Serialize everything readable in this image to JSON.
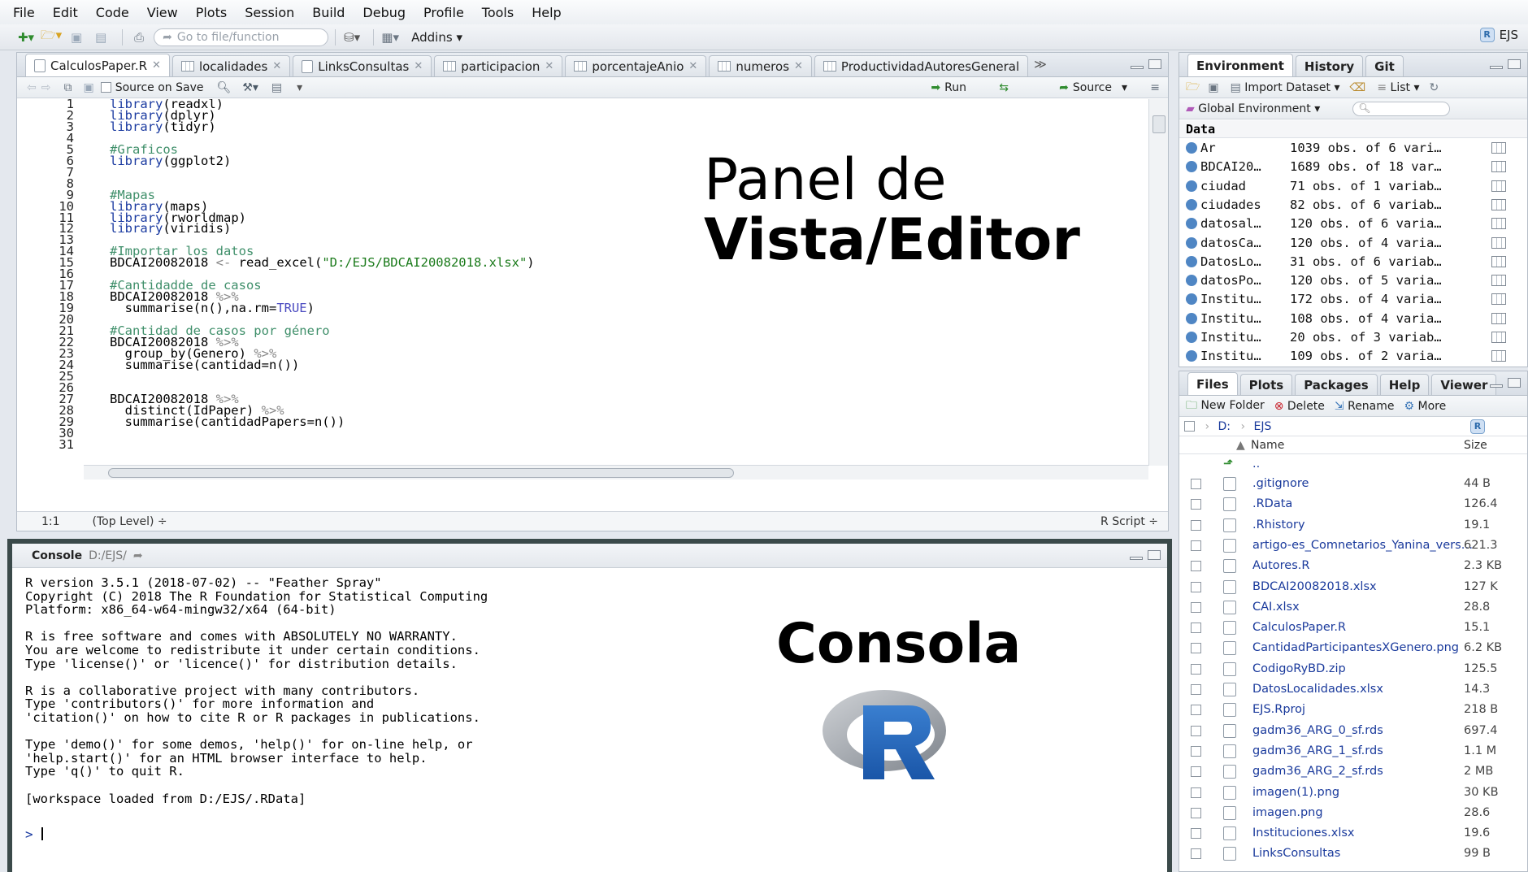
{
  "menu": [
    "File",
    "Edit",
    "Code",
    "View",
    "Plots",
    "Session",
    "Build",
    "Debug",
    "Profile",
    "Tools",
    "Help"
  ],
  "toolbar": {
    "goto_placeholder": "Go to file/function",
    "addins": "Addins",
    "project": "EJS"
  },
  "editor": {
    "tabs": [
      {
        "label": "CalculosPaper.R",
        "kind": "file"
      },
      {
        "label": "localidades",
        "kind": "table"
      },
      {
        "label": "LinksConsultas",
        "kind": "file"
      },
      {
        "label": "participacion",
        "kind": "table"
      },
      {
        "label": "porcentajeAnio",
        "kind": "table"
      },
      {
        "label": "numeros",
        "kind": "table"
      },
      {
        "label": "ProductividadAutoresGeneral",
        "kind": "table"
      }
    ],
    "source_on_save": "Source on Save",
    "run": "Run",
    "source": "Source",
    "lines": [
      {
        "n": "1",
        "parts": [
          [
            "kw",
            "library"
          ],
          [
            "plain",
            "(readxl)"
          ]
        ]
      },
      {
        "n": "2",
        "parts": [
          [
            "kw",
            "library"
          ],
          [
            "plain",
            "(dplyr)"
          ]
        ]
      },
      {
        "n": "3",
        "parts": [
          [
            "kw",
            "library"
          ],
          [
            "plain",
            "(tidyr)"
          ]
        ]
      },
      {
        "n": "4",
        "parts": []
      },
      {
        "n": "5",
        "parts": [
          [
            "cm",
            "#Graficos"
          ]
        ]
      },
      {
        "n": "6",
        "parts": [
          [
            "kw",
            "library"
          ],
          [
            "plain",
            "(ggplot2)"
          ]
        ]
      },
      {
        "n": "7",
        "parts": []
      },
      {
        "n": "8",
        "parts": []
      },
      {
        "n": "9",
        "parts": [
          [
            "cm",
            "#Mapas"
          ]
        ]
      },
      {
        "n": "10",
        "parts": [
          [
            "kw",
            "library"
          ],
          [
            "plain",
            "(maps)"
          ]
        ]
      },
      {
        "n": "11",
        "parts": [
          [
            "kw",
            "library"
          ],
          [
            "plain",
            "(rworldmap)"
          ]
        ]
      },
      {
        "n": "12",
        "parts": [
          [
            "kw",
            "library"
          ],
          [
            "plain",
            "(viridis)"
          ]
        ]
      },
      {
        "n": "13",
        "parts": []
      },
      {
        "n": "14",
        "parts": [
          [
            "cm",
            "#Importar los datos"
          ]
        ]
      },
      {
        "n": "15",
        "parts": [
          [
            "plain",
            "BDCAI20082018 "
          ],
          [
            "op",
            "<-"
          ],
          [
            "plain",
            " read_excel("
          ],
          [
            "str",
            "\"D:/EJS/BDCAI20082018.xlsx\""
          ],
          [
            "plain",
            ")"
          ]
        ]
      },
      {
        "n": "16",
        "parts": []
      },
      {
        "n": "17",
        "parts": [
          [
            "cm",
            "#Cantidadde de casos"
          ]
        ]
      },
      {
        "n": "18",
        "parts": [
          [
            "plain",
            "BDCAI20082018 "
          ],
          [
            "op",
            "%>%"
          ]
        ]
      },
      {
        "n": "19",
        "parts": [
          [
            "plain",
            "  summarise(n(),na.rm="
          ],
          [
            "cn",
            "TRUE"
          ],
          [
            "plain",
            ")"
          ]
        ]
      },
      {
        "n": "20",
        "parts": []
      },
      {
        "n": "21",
        "parts": [
          [
            "cm",
            "#Cantidad de casos por género"
          ]
        ]
      },
      {
        "n": "22",
        "parts": [
          [
            "plain",
            "BDCAI20082018 "
          ],
          [
            "op",
            "%>%"
          ]
        ]
      },
      {
        "n": "23",
        "parts": [
          [
            "plain",
            "  group_by(Genero) "
          ],
          [
            "op",
            "%>%"
          ]
        ]
      },
      {
        "n": "24",
        "parts": [
          [
            "plain",
            "  summarise(cantidad=n())"
          ]
        ]
      },
      {
        "n": "25",
        "parts": []
      },
      {
        "n": "26",
        "parts": []
      },
      {
        "n": "27",
        "parts": [
          [
            "plain",
            "BDCAI20082018 "
          ],
          [
            "op",
            "%>%"
          ]
        ]
      },
      {
        "n": "28",
        "parts": [
          [
            "plain",
            "  distinct(IdPaper) "
          ],
          [
            "op",
            "%>%"
          ]
        ]
      },
      {
        "n": "29",
        "parts": [
          [
            "plain",
            "  summarise(cantidadPapers=n())"
          ]
        ]
      },
      {
        "n": "30",
        "parts": []
      },
      {
        "n": "31",
        "parts": []
      }
    ],
    "status_pos": "1:1",
    "status_scope": "(Top Level) ÷",
    "status_type": "R Script ÷",
    "overlay_line1": "Panel de",
    "overlay_line2": "Vista/Editor"
  },
  "console": {
    "title": "Console",
    "path": "D:/EJS/",
    "text": "R version 3.5.1 (2018-07-02) -- \"Feather Spray\"\nCopyright (C) 2018 The R Foundation for Statistical Computing\nPlatform: x86_64-w64-mingw32/x64 (64-bit)\n\nR is free software and comes with ABSOLUTELY NO WARRANTY.\nYou are welcome to redistribute it under certain conditions.\nType 'license()' or 'licence()' for distribution details.\n\nR is a collaborative project with many contributors.\nType 'contributors()' for more information and\n'citation()' on how to cite R or R packages in publications.\n\nType 'demo()' for some demos, 'help()' for on-line help, or\n'help.start()' for an HTML browser interface to help.\nType 'q()' to quit R.\n\n[workspace loaded from D:/EJS/.RData]",
    "prompt": ">",
    "overlay": "Consola"
  },
  "environment": {
    "tabs": [
      "Environment",
      "History",
      "Git"
    ],
    "import_dataset": "Import Dataset",
    "list": "List",
    "global_env": "Global Environment",
    "section": "Data",
    "rows": [
      {
        "name": "Ar",
        "desc": "1039 obs. of 6 vari…"
      },
      {
        "name": "BDCAI20…",
        "desc": "1689 obs. of 18 var…"
      },
      {
        "name": "ciudad",
        "desc": "71 obs. of 1 variab…"
      },
      {
        "name": "ciudades",
        "desc": "82 obs. of 6 variab…"
      },
      {
        "name": "datosal…",
        "desc": "120 obs. of 6 varia…"
      },
      {
        "name": "datosCa…",
        "desc": "120 obs. of 4 varia…"
      },
      {
        "name": "DatosLo…",
        "desc": "31 obs. of 6 variab…"
      },
      {
        "name": "datosPo…",
        "desc": "120 obs. of 5 varia…"
      },
      {
        "name": "Institu…",
        "desc": "172 obs. of 4 varia…"
      },
      {
        "name": "Institu…",
        "desc": "108 obs. of 4 varia…"
      },
      {
        "name": "Institu…",
        "desc": "20 obs. of 3 variab…"
      },
      {
        "name": "Institu…",
        "desc": "109 obs. of 2 varia…"
      }
    ]
  },
  "files": {
    "tabs": [
      "Files",
      "Plots",
      "Packages",
      "Help",
      "Viewer"
    ],
    "new_folder": "New Folder",
    "delete": "Delete",
    "rename": "Rename",
    "more": "More",
    "breadcrumb": [
      "D:",
      "EJS"
    ],
    "col_name": "Name",
    "col_size": "Size",
    "parent": "..",
    "rows": [
      {
        "name": ".gitignore",
        "size": "44 B"
      },
      {
        "name": ".RData",
        "size": "126.4"
      },
      {
        "name": ".Rhistory",
        "size": "19.1"
      },
      {
        "name": "artigo-es_Comnetarios_Yanina_vers…",
        "size": "621.3"
      },
      {
        "name": "Autores.R",
        "size": "2.3 KB"
      },
      {
        "name": "BDCAI20082018.xlsx",
        "size": "127 K"
      },
      {
        "name": "CAI.xlsx",
        "size": "28.8"
      },
      {
        "name": "CalculosPaper.R",
        "size": "15.1"
      },
      {
        "name": "CantidadParticipantesXGenero.png",
        "size": "6.2 KB"
      },
      {
        "name": "CodigoRyBD.zip",
        "size": "125.5"
      },
      {
        "name": "DatosLocalidades.xlsx",
        "size": "14.3"
      },
      {
        "name": "EJS.Rproj",
        "size": "218 B"
      },
      {
        "name": "gadm36_ARG_0_sf.rds",
        "size": "697.4"
      },
      {
        "name": "gadm36_ARG_1_sf.rds",
        "size": "1.1 M"
      },
      {
        "name": "gadm36_ARG_2_sf.rds",
        "size": "2 MB"
      },
      {
        "name": "imagen(1).png",
        "size": "30 KB"
      },
      {
        "name": "imagen.png",
        "size": "28.6"
      },
      {
        "name": "Instituciones.xlsx",
        "size": "19.6"
      },
      {
        "name": "LinksConsultas",
        "size": "99 B"
      }
    ]
  }
}
